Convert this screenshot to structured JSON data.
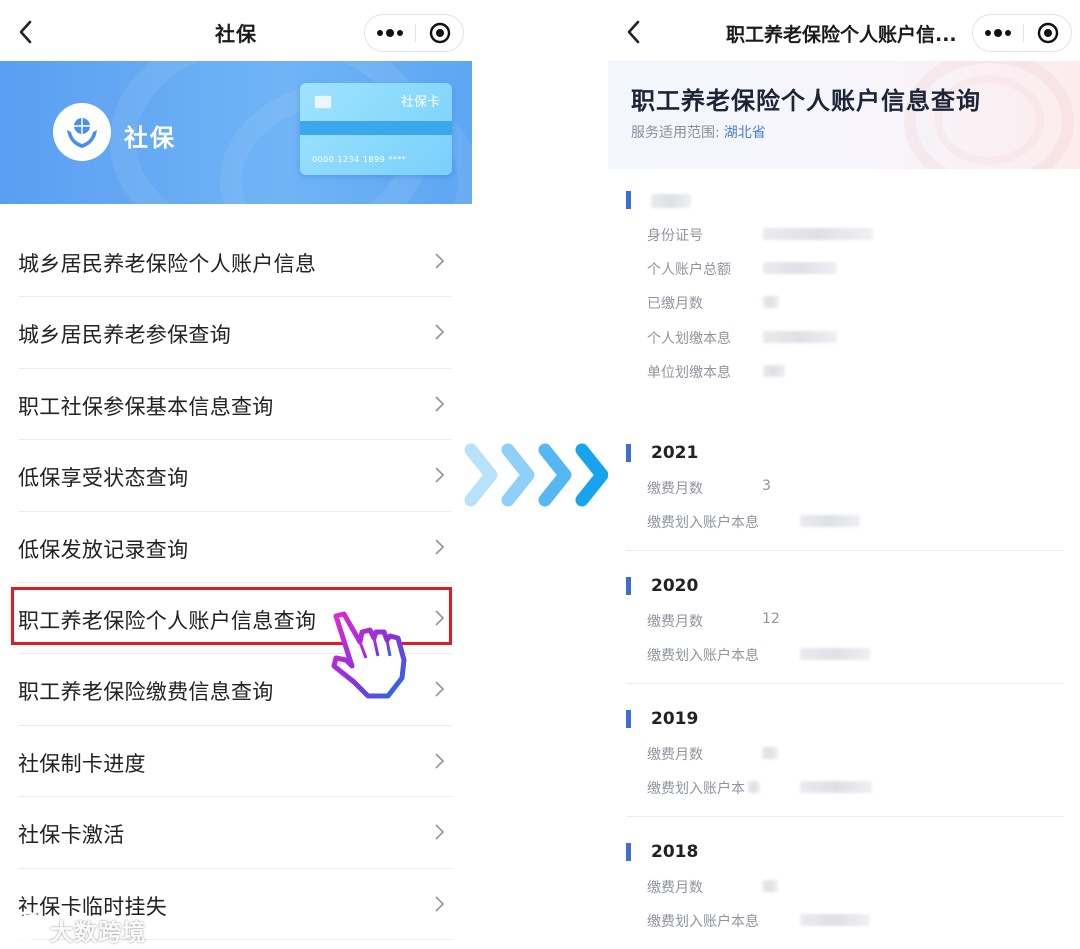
{
  "left": {
    "nav_title": "社保",
    "banner": {
      "name": "社保",
      "card_label": "社保卡",
      "card_number": "0000  1234  1899  ****"
    },
    "menu": [
      {
        "label": "城乡居民养老保险个人账户信息"
      },
      {
        "label": "城乡居民养老参保查询"
      },
      {
        "label": "职工社保参保基本信息查询"
      },
      {
        "label": "低保享受状态查询"
      },
      {
        "label": "低保发放记录查询"
      },
      {
        "label": "职工养老保险个人账户信息查询",
        "highlighted": true
      },
      {
        "label": "职工养老保险缴费信息查询"
      },
      {
        "label": "社保制卡进度"
      },
      {
        "label": "社保卡激活"
      },
      {
        "label": "社保卡临时挂失"
      }
    ],
    "watermark": "大数跨境"
  },
  "right": {
    "nav_title": "职工养老保险个人账户信...",
    "header": {
      "title": "职工养老保险个人账户信息查询",
      "scope_label": "服务适用范围:",
      "scope_value": "湖北省"
    },
    "profile": {
      "id_label": "身份证号",
      "total_label": "个人账户总额",
      "months_label": "已缴月数",
      "personal_label": "个人划缴本息",
      "unit_label": "单位划缴本息"
    },
    "years": [
      {
        "year": "2021",
        "months_label": "缴费月数",
        "months_value": "3",
        "amount_label": "缴费划入账户本息"
      },
      {
        "year": "2020",
        "months_label": "缴费月数",
        "months_value": "12",
        "amount_label": "缴费划入账户本息"
      },
      {
        "year": "2019",
        "months_label": "缴费月数",
        "months_value": "",
        "amount_label": "缴费划入账户本"
      },
      {
        "year": "2018",
        "months_label": "缴费月数",
        "months_value": "",
        "amount_label": "缴费划入账户本息"
      }
    ]
  },
  "colors": {
    "banner_blue": "#5a9ef2",
    "accent_blue": "#3d6fd1",
    "highlight_red": "#e01c22",
    "arrow_light": "#a9daf8",
    "arrow_dark": "#17a3ee"
  }
}
